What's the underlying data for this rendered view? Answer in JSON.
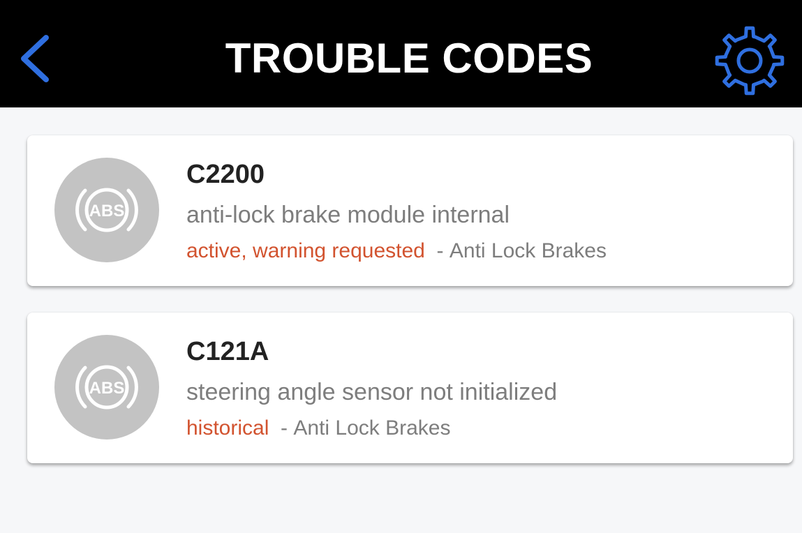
{
  "header": {
    "title": "TROUBLE CODES",
    "back_icon": "chevron-left-icon",
    "settings_icon": "gear-icon",
    "accent_color": "#2f6fe0"
  },
  "codes": [
    {
      "icon": "abs-warning-icon",
      "icon_text": "ABS",
      "code": "C2200",
      "description": "anti-lock brake module internal",
      "status": "active, warning requested",
      "separator": "-",
      "module": "Anti Lock Brakes"
    },
    {
      "icon": "abs-warning-icon",
      "icon_text": "ABS",
      "code": "C121A",
      "description": "steering angle sensor not initialized",
      "status": "historical",
      "separator": "-",
      "module": "Anti Lock Brakes"
    }
  ],
  "colors": {
    "header_bg": "#000000",
    "page_bg": "#f6f7f9",
    "status": "#d2532f",
    "muted_text": "#7d7d7d",
    "code_text": "#222222",
    "icon_circle": "#c3c3c3"
  }
}
